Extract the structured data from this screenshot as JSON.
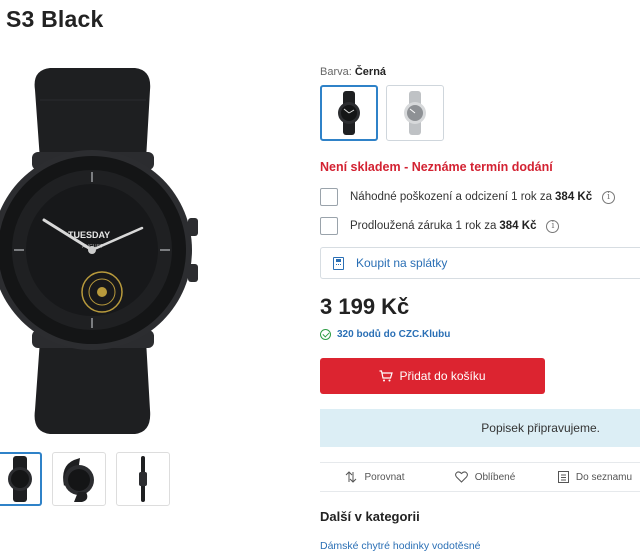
{
  "product": {
    "title": "S3 Black",
    "image_alt_icon": "smartwatch-image"
  },
  "color": {
    "label": "Barva:",
    "selected": "Černá",
    "swatches": [
      {
        "name": "black-watch",
        "selected": true
      },
      {
        "name": "silver-watch",
        "selected": false
      }
    ]
  },
  "stock_status": "Není skladem - Neznáme termín dodání",
  "options": [
    {
      "label": "Náhodné poškození a odcizení 1 rok za",
      "price": "384 Kč",
      "checked": false
    },
    {
      "label": "Prodloužená záruka 1 rok za",
      "price": "384 Kč",
      "checked": false
    }
  ],
  "installments_label": "Koupit na splátky",
  "price": "3 199 Kč",
  "club_points": "320 bodů do CZC.Klubu",
  "add_to_cart_label": "Přidat do košíku",
  "description_note": "Popisek připravujeme.",
  "actions": {
    "compare": "Porovnat",
    "favorite": "Oblíbené",
    "list": "Do seznamu"
  },
  "category": {
    "title": "Další v kategorii",
    "link": "Dámské chytré hodinky vodotěsné"
  },
  "watch_face": {
    "day": "TUESDAY",
    "month": "AUGUST"
  },
  "colors": {
    "accent_red": "#dc2430",
    "link_blue": "#2a6fb5",
    "stock_red": "#d32232",
    "note_bg": "#dceef5"
  }
}
